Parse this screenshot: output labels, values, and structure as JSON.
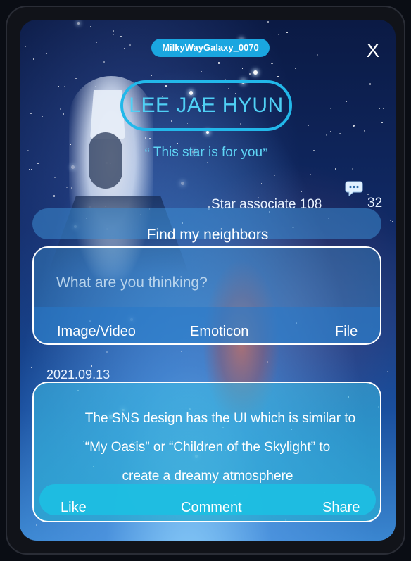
{
  "header": {
    "username": "MilkyWayGalaxy_0070",
    "close_glyph": "X",
    "display_name": "LEE JAE HYUN",
    "quote_open": "“",
    "quote_text": "This star is for you",
    "quote_close": "”"
  },
  "stats": {
    "star_associate_label": "Star associate 108",
    "message_count": "32",
    "message_icon": "chat-bubble-icon"
  },
  "neighbors": {
    "label": "Find my neighbors"
  },
  "composer": {
    "placeholder": "What are you thinking?",
    "tools": [
      "Image/Video",
      "Emoticon",
      "File"
    ]
  },
  "feed": {
    "date": "2021.09.13",
    "lines": [
      "The SNS design has the UI which is similar to",
      "“My Oasis” or “Children of the Skylight” to",
      "create a dreamy atmosphere"
    ],
    "actions": [
      "Like",
      "Comment",
      "Share"
    ]
  },
  "colors": {
    "accent": "#1aa6e0",
    "name_text": "#4fd0f5",
    "card": "#3cbee6"
  }
}
